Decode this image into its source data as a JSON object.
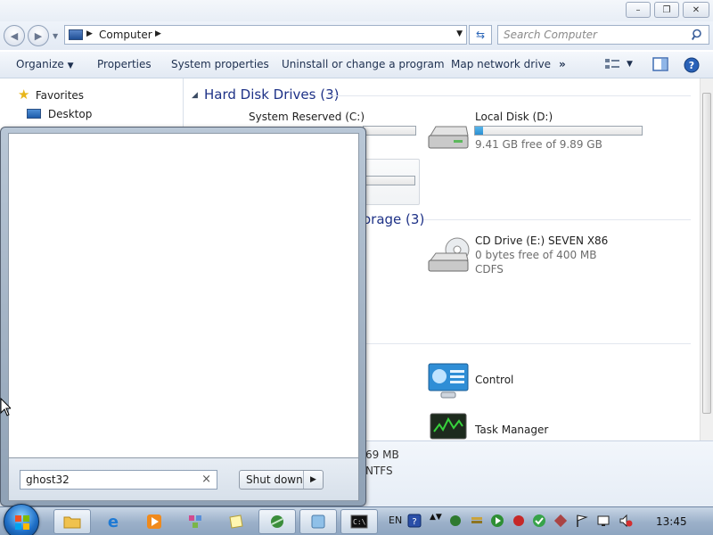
{
  "window": {
    "minimize_label": "–",
    "maximize_label": "❐",
    "close_label": "✕"
  },
  "address": {
    "path": "Computer",
    "search_placeholder": "Search Computer"
  },
  "toolbar": {
    "organize": "Organize",
    "properties": "Properties",
    "system_properties": "System properties",
    "uninstall": "Uninstall or change a program",
    "map_drive": "Map network drive",
    "more": "»"
  },
  "nav": {
    "favorites": "Favorites",
    "desktop": "Desktop"
  },
  "content": {
    "hdd_group": "Hard Disk Drives (3)",
    "drives": [
      {
        "name": "System Reserved (C:)"
      },
      {
        "name": "Local Disk (D:)",
        "free": "9.41 GB free of 9.89 GB",
        "used_fraction": 0.05
      }
    ],
    "removable_group_partial": "orage (3)",
    "cd": {
      "name": "CD Drive (E:) SEVEN X86",
      "free": "0 bytes free of 400 MB",
      "fs": "CDFS"
    },
    "other": [
      {
        "name": "Control"
      },
      {
        "name": "Task Manager"
      }
    ]
  },
  "details": {
    "line1": "69 MB",
    "line2": "NTFS"
  },
  "start_menu": {
    "search_value": "ghost32",
    "clear_label": "×",
    "shutdown_label": "Shut down",
    "shutdown_arrow": "▶"
  },
  "taskbar": {
    "language": "EN",
    "time": "13:45"
  },
  "colors": {
    "group_header": "#1e3287",
    "capacity_fill": "#2a8fd2",
    "taskbar": "#9bb0c9"
  }
}
